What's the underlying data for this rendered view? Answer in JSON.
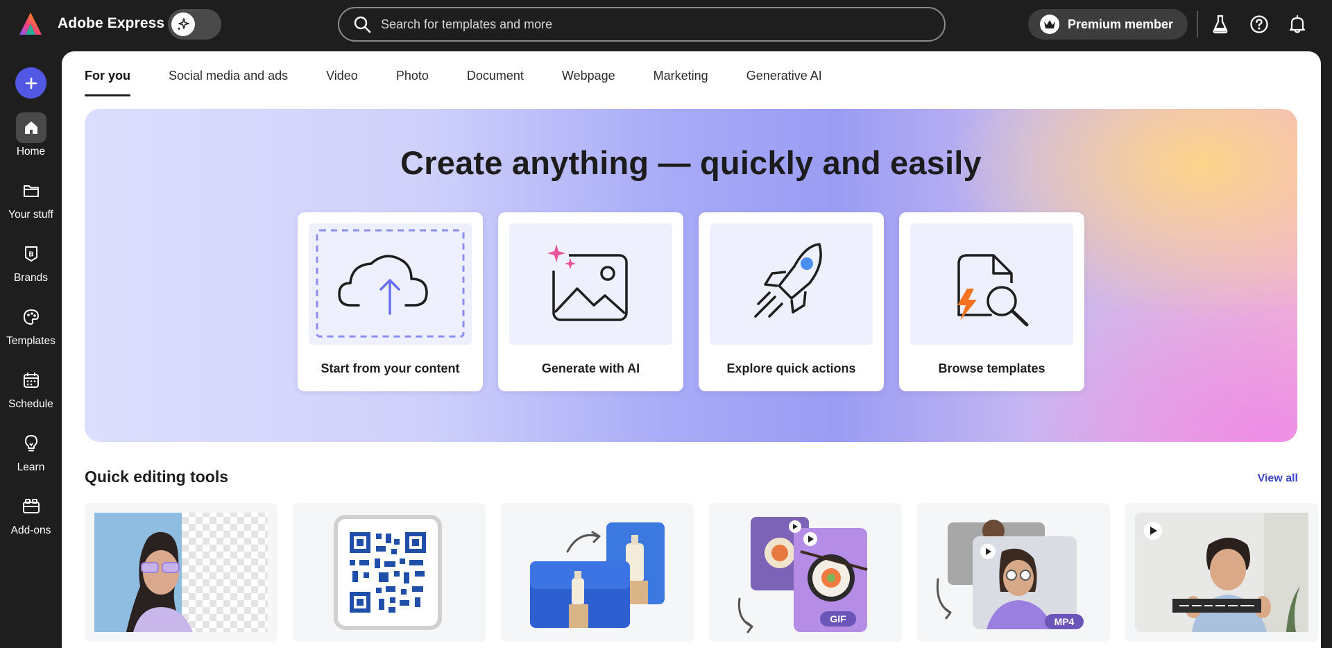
{
  "app": {
    "name": "Adobe Express"
  },
  "search": {
    "placeholder": "Search for templates and more"
  },
  "header": {
    "premium_label": "Premium member"
  },
  "rail": {
    "items": [
      {
        "label": "Home",
        "icon": "home-icon"
      },
      {
        "label": "Your stuff",
        "icon": "folder-icon"
      },
      {
        "label": "Brands",
        "icon": "brand-icon"
      },
      {
        "label": "Templates",
        "icon": "templates-icon"
      },
      {
        "label": "Schedule",
        "icon": "calendar-icon"
      },
      {
        "label": "Learn",
        "icon": "lightbulb-icon"
      },
      {
        "label": "Add-ons",
        "icon": "addons-icon"
      }
    ]
  },
  "tabs": [
    {
      "label": "For you"
    },
    {
      "label": "Social media and ads"
    },
    {
      "label": "Video"
    },
    {
      "label": "Photo"
    },
    {
      "label": "Document"
    },
    {
      "label": "Webpage"
    },
    {
      "label": "Marketing"
    },
    {
      "label": "Generative AI"
    }
  ],
  "hero": {
    "title": "Create anything — quickly and easily",
    "cards": [
      {
        "label": "Start from your content",
        "icon": "upload-cloud-icon"
      },
      {
        "label": "Generate with AI",
        "icon": "ai-image-icon"
      },
      {
        "label": "Explore quick actions",
        "icon": "rocket-icon"
      },
      {
        "label": "Browse templates",
        "icon": "search-template-icon"
      }
    ]
  },
  "quick_tools": {
    "title": "Quick editing tools",
    "view_all": "View all",
    "badges": {
      "gif": "GIF",
      "mp4": "MP4"
    }
  },
  "colors": {
    "accent": "#5258e4",
    "link": "#3d48c9",
    "chrome": "#1e1e1e"
  }
}
